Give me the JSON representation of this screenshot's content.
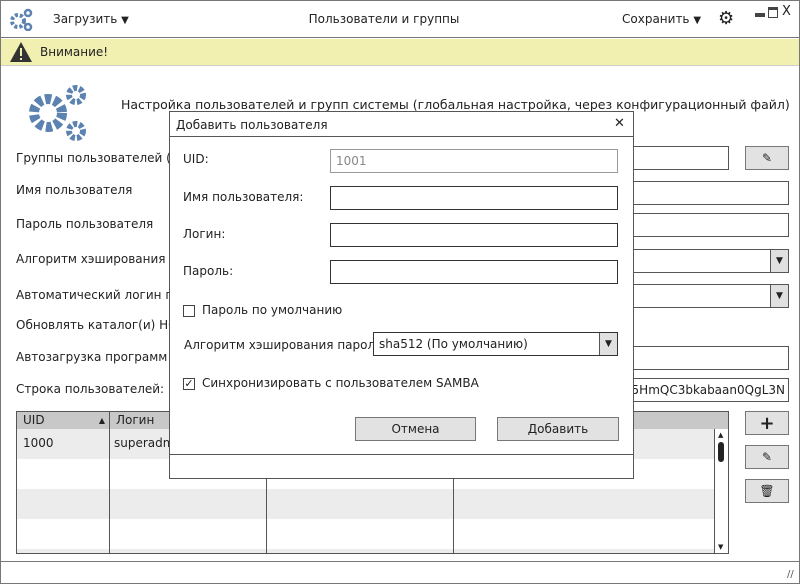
{
  "titlebar": {
    "load_label": "Загрузить",
    "title": "Пользователи и группы",
    "save_label": "Сохранить",
    "minimize": "▁",
    "maximize": "□",
    "close": "X"
  },
  "warning": {
    "text": "Внимание!"
  },
  "header": {
    "title": "Настройка пользователей и групп системы (глобальная настройка, через конфигурационный файл)"
  },
  "form": {
    "labels": [
      "Группы пользователей (по",
      "Имя пользователя",
      "Пароль пользователя",
      "Алгоритм хэширования па",
      "Автоматический логин пол",
      "Обновлять каталог(и) HOI",
      "Автозагрузка программ п",
      "Строка пользователей:"
    ],
    "user_string_value": "5HmQC3bkabaan0QgL3N"
  },
  "table": {
    "columns": [
      "UID",
      "Логин",
      "",
      ""
    ],
    "sort_indicator": "▲",
    "rows": [
      [
        "1000",
        "superadm",
        "",
        ""
      ]
    ]
  },
  "side_buttons": {
    "add": "+",
    "edit": "✎",
    "delete": "🗑"
  },
  "dialog": {
    "title": "Добавить пользователя",
    "close": "✕",
    "uid_label": "UID:",
    "uid_value": "1001",
    "username_label": "Имя пользователя:",
    "username_value": "",
    "login_label": "Логин:",
    "login_value": "",
    "password_label": "Пароль:",
    "password_value": "",
    "default_password_label": "Пароль по умолчанию",
    "default_password_checked": false,
    "hash_label": "Алгоритм хэширования пароля:",
    "hash_value": "sha512 (По умолчанию)",
    "samba_label": "Синхронизировать с пользователем SAMBA",
    "samba_checked": true,
    "cancel_label": "Отмена",
    "add_label": "Добавить"
  },
  "colors": {
    "accent": "#5b82b0",
    "warning_bg": "#f2f0b0"
  }
}
